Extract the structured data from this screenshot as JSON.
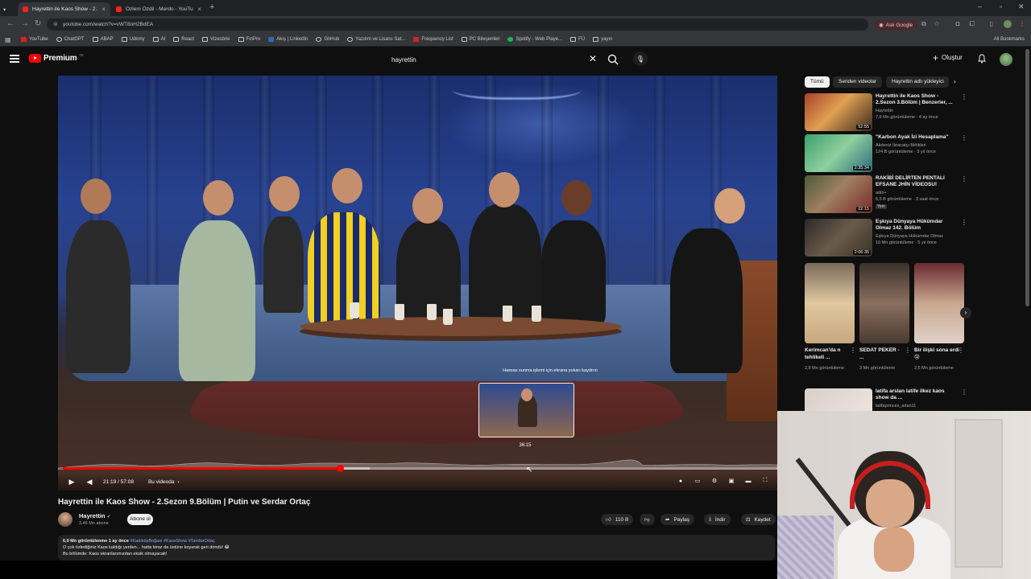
{
  "browser": {
    "tabs": [
      {
        "title": "Hayrettin ile Kaos Show - 2.Sezo",
        "active": true
      },
      {
        "title": "Özlem Özdil - Merdo - YouTube",
        "active": false
      }
    ],
    "url": "youtube.com/watch?v=vWT8oH2BdEA",
    "ask_google": "Ask Google",
    "bookmarks": [
      {
        "label": "YouTube",
        "icon": "youtube-icon"
      },
      {
        "label": "ChatGPT",
        "icon": "chatgpt-icon"
      },
      {
        "label": "ABAP",
        "icon": "folder-icon"
      },
      {
        "label": "Udemy",
        "icon": "folder-icon"
      },
      {
        "label": "AI",
        "icon": "folder-icon"
      },
      {
        "label": "React",
        "icon": "folder-icon"
      },
      {
        "label": "Vizesbrie",
        "icon": "folder-icon"
      },
      {
        "label": "FinPro",
        "icon": "folder-icon"
      },
      {
        "label": "Akış | LinkedIn",
        "icon": "linkedin-icon"
      },
      {
        "label": "GitHub",
        "icon": "github-icon"
      },
      {
        "label": "Yazılım ve Lisans Sat...",
        "icon": "globe-icon"
      },
      {
        "label": "Frequency List",
        "icon": "page-icon"
      },
      {
        "label": "PC Bileşenleri",
        "icon": "folder-icon"
      },
      {
        "label": "Spotify - Web Playe...",
        "icon": "spotify-icon"
      },
      {
        "label": "FÜ",
        "icon": "folder-icon"
      },
      {
        "label": "yayın",
        "icon": "folder-icon"
      }
    ],
    "all_bookmarks": "All Bookmarks"
  },
  "masthead": {
    "logo_text": "Premium",
    "logo_sup": "TR",
    "search_value": "hayrettin",
    "create_label": "Oluştur"
  },
  "player": {
    "preview_label": "Hassas sunma işlemi için ekrana yukarı kaydırın",
    "preview_time": "36:15",
    "current_time": "21:19 / 57:08",
    "chapter": "Bu videoda",
    "progress_played": 0.388,
    "progress_buffer": 0.43
  },
  "video": {
    "title": "Hayrettin ile Kaos Show - 2.Sezon 9.Bölüm | Putin ve Serdar Ortaç",
    "channel": "Hayrettin",
    "subscribers": "3,46 Mn abone",
    "subscribe_label": "Abone ol",
    "likes": "110 B",
    "share_label": "Paylaş",
    "download_label": "İndir",
    "save_label": "Kaydet",
    "desc_meta": "6,9 Mn görüntülenme  1 ay önce",
    "desc_tags": "#KadıköyBoğası #KaosShow #SerdarOrtaç",
    "desc_line1": "O çok özlediğiniz Kaos kaldığı yerden... hatta biraz da üstüne koyarak geri döndü! 😂",
    "desc_line2": "Bu bölümde: Kaos ekranlarımızdan eksik olmayacak!"
  },
  "sidebar": {
    "chips": [
      "Tümü",
      "Seriden videolar",
      "Hayrettin adlı yükleyici"
    ],
    "recommendations": [
      {
        "title": "Hayrettin ile Kaos Show - 2.Sezon 3.Bölüm | Benzerler, ...",
        "channel": "Hayrettin",
        "stats": "7,6 Mn görüntüleme · 4 ay önce",
        "duration": "52:55",
        "badge": ""
      },
      {
        "title": "\"Karbon Ayak İzi Hesaplama\"",
        "channel": "Akdeniz İkracatçı Birlikleri",
        "stats": "124 B görüntüleme · 3 yıl önce",
        "duration": "2:35:34",
        "badge": ""
      },
      {
        "title": "RAKİBİ DELİRTEN PENTALI EFSANE JHİN VİDEOSU!",
        "channel": "adio+",
        "stats": "6,5 B görüntüleme · 3 saat önce",
        "duration": "22:15",
        "badge": "Yeni"
      },
      {
        "title": "Eşkıya Dünyaya Hükümdar Olmaz 142. Bölüm",
        "channel": "Eşkıya Dünyaya Hükümdar Olmaz",
        "stats": "10 Mn görüntüleme · 5 yıl önce",
        "duration": "2:06:35",
        "badge": ""
      },
      {
        "title": "latifa arslan latife ilkez kaos show da ...",
        "channel": "latifaprinces_arlan11",
        "stats": "",
        "duration": "",
        "badge": ""
      }
    ],
    "shorts": [
      {
        "title": "Kerimcan'da n tehlikeli ...",
        "views": "2,8 Mn görüntüleme"
      },
      {
        "title": "SEDAT PEKER - ...",
        "views": "3 Mn görüntüleme"
      },
      {
        "title": "Bir ilişki sona erdi 😢",
        "views": "2,5 Mn görüntüleme"
      }
    ]
  }
}
